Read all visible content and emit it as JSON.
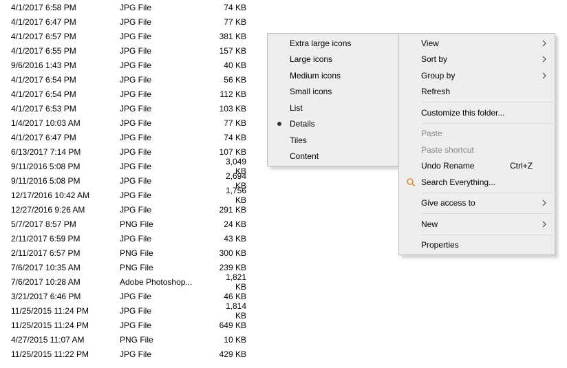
{
  "files": [
    {
      "date": "4/1/2017 6:58 PM",
      "type": "JPG File",
      "size": "74 KB"
    },
    {
      "date": "4/1/2017 6:47 PM",
      "type": "JPG File",
      "size": "77 KB"
    },
    {
      "date": "4/1/2017 6:57 PM",
      "type": "JPG File",
      "size": "381 KB"
    },
    {
      "date": "4/1/2017 6:55 PM",
      "type": "JPG File",
      "size": "157 KB"
    },
    {
      "date": "9/6/2016 1:43 PM",
      "type": "JPG File",
      "size": "40 KB"
    },
    {
      "date": "4/1/2017 6:54 PM",
      "type": "JPG File",
      "size": "56 KB"
    },
    {
      "date": "4/1/2017 6:54 PM",
      "type": "JPG File",
      "size": "112 KB"
    },
    {
      "date": "4/1/2017 6:53 PM",
      "type": "JPG File",
      "size": "103 KB"
    },
    {
      "date": "1/4/2017 10:03 AM",
      "type": "JPG File",
      "size": "77 KB"
    },
    {
      "date": "4/1/2017 6:47 PM",
      "type": "JPG File",
      "size": "74 KB"
    },
    {
      "date": "6/13/2017 7:14 PM",
      "type": "JPG File",
      "size": "107 KB"
    },
    {
      "date": "9/11/2016 5:08 PM",
      "type": "JPG File",
      "size": "3,049 KB"
    },
    {
      "date": "9/11/2016 5:08 PM",
      "type": "JPG File",
      "size": "2,694 KB"
    },
    {
      "date": "12/17/2016 10:42 AM",
      "type": "JPG File",
      "size": "1,756 KB"
    },
    {
      "date": "12/27/2016 9:26 AM",
      "type": "JPG File",
      "size": "291 KB"
    },
    {
      "date": "5/7/2017 8:57 PM",
      "type": "PNG File",
      "size": "24 KB"
    },
    {
      "date": "2/11/2017 6:59 PM",
      "type": "JPG File",
      "size": "43 KB"
    },
    {
      "date": "2/11/2017 6:57 PM",
      "type": "PNG File",
      "size": "300 KB"
    },
    {
      "date": "7/6/2017 10:35 AM",
      "type": "PNG File",
      "size": "239 KB"
    },
    {
      "date": "7/6/2017 10:28 AM",
      "type": "Adobe Photoshop...",
      "size": "1,821 KB"
    },
    {
      "date": "3/21/2017 6:46 PM",
      "type": "JPG File",
      "size": "46 KB"
    },
    {
      "date": "11/25/2015 11:24 PM",
      "type": "JPG File",
      "size": "1,814 KB"
    },
    {
      "date": "11/25/2015 11:24 PM",
      "type": "JPG File",
      "size": "649 KB"
    },
    {
      "date": "4/27/2015 11:07 AM",
      "type": "PNG File",
      "size": "10 KB"
    },
    {
      "date": "11/25/2015 11:22 PM",
      "type": "JPG File",
      "size": "429 KB"
    }
  ],
  "viewSubmenu": {
    "items": [
      {
        "label": "Extra large icons",
        "selected": false
      },
      {
        "label": "Large icons",
        "selected": false
      },
      {
        "label": "Medium icons",
        "selected": false
      },
      {
        "label": "Small icons",
        "selected": false
      },
      {
        "label": "List",
        "selected": false
      },
      {
        "label": "Details",
        "selected": true
      },
      {
        "label": "Tiles",
        "selected": false
      },
      {
        "label": "Content",
        "selected": false
      }
    ]
  },
  "contextMenu": {
    "view": "View",
    "sortBy": "Sort by",
    "groupBy": "Group by",
    "refresh": "Refresh",
    "customize": "Customize this folder...",
    "paste": "Paste",
    "pasteShortcut": "Paste shortcut",
    "undo": "Undo Rename",
    "undoShortcut": "Ctrl+Z",
    "search": "Search Everything...",
    "giveAccess": "Give access to",
    "new": "New",
    "properties": "Properties"
  }
}
